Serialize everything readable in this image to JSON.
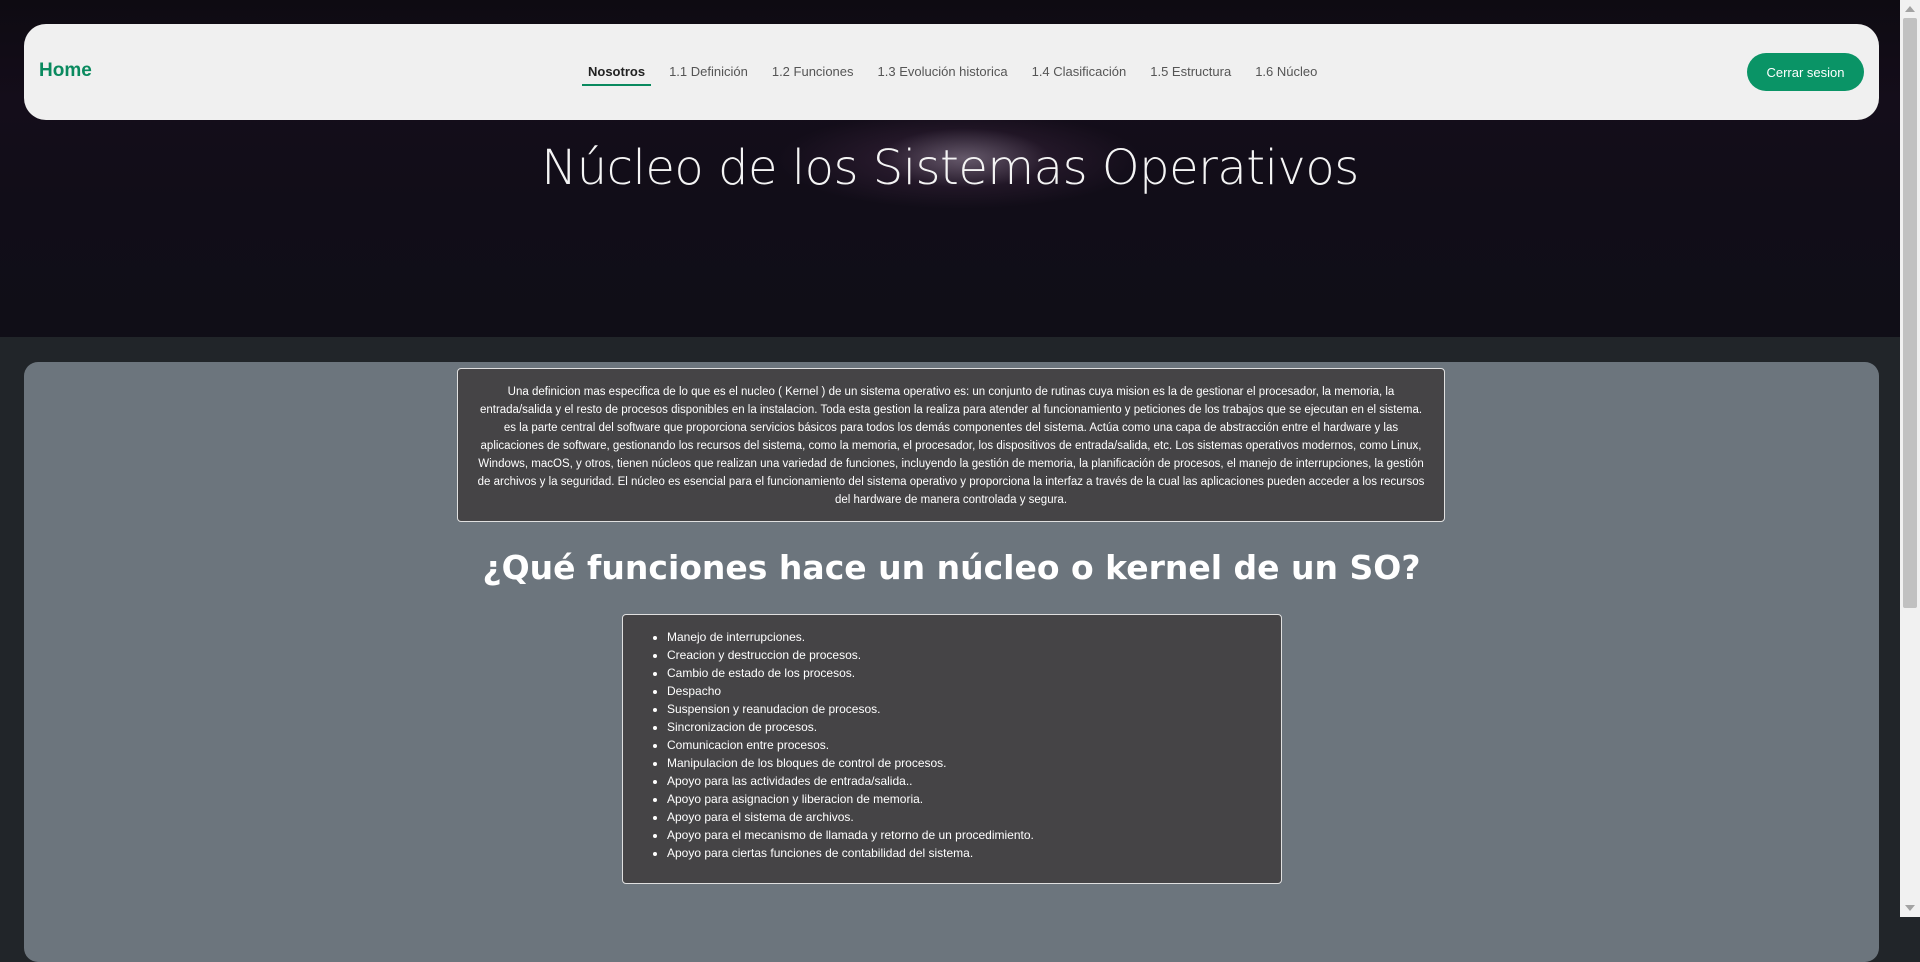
{
  "navbar": {
    "brand": "Home",
    "links": [
      {
        "label": "Nosotros",
        "active": true
      },
      {
        "label": "1.1 Definición"
      },
      {
        "label": "1.2 Funciones"
      },
      {
        "label": "1.3 Evolución historica"
      },
      {
        "label": "1.4 Clasificación"
      },
      {
        "label": "1.5 Estructura"
      },
      {
        "label": "1.6 Núcleo"
      }
    ],
    "logout_label": "Cerrar sesion"
  },
  "hero": {
    "title": "Núcleo de los Sistemas Operativos"
  },
  "main": {
    "intro_text": "Una definicion mas especifica de lo que es el nucleo ( Kernel ) de un sistema operativo es: un conjunto de rutinas cuya mision es la de gestionar el procesador, la memoria, la entrada/salida y el resto de procesos disponibles en la instalacion. Toda esta gestion la realiza para atender al funcionamiento y peticiones de los trabajos que se ejecutan en el sistema. es la parte central del software que proporciona servicios básicos para todos los demás componentes del sistema. Actúa como una capa de abstracción entre el hardware y las aplicaciones de software, gestionando los recursos del sistema, como la memoria, el procesador, los dispositivos de entrada/salida, etc. Los sistemas operativos modernos, como Linux, Windows, macOS, y otros, tienen núcleos que realizan una variedad de funciones, incluyendo la gestión de memoria, la planificación de procesos, el manejo de interrupciones, la gestión de archivos y la seguridad. El núcleo es esencial para el funcionamiento del sistema operativo y proporciona la interfaz a través de la cual las aplicaciones pueden acceder a los recursos del hardware de manera controlada y segura.",
    "section_title": "¿Qué funciones hace un núcleo o kernel de un SO?",
    "functions": [
      "Manejo de interrupciones.",
      "Creacion y destruccion de procesos.",
      "Cambio de estado de los procesos.",
      "Despacho",
      "Suspension y reanudacion de procesos.",
      "Sincronizacion de procesos.",
      "Comunicacion entre procesos.",
      "Manipulacion de los bloques de control de procesos.",
      "Apoyo para las actividades de entrada/salida..",
      "Apoyo para asignacion y liberacion de memoria.",
      "Apoyo para el sistema de archivos.",
      "Apoyo para el mecanismo de llamada y retorno de un procedimiento.",
      "Apoyo para ciertas funciones de contabilidad del sistema."
    ]
  },
  "colors": {
    "accent": "#0a9466",
    "brand": "#0a8a5f",
    "main_bg": "#6c757d",
    "box_bg": "#454446"
  },
  "icons": [
    "scroll-up-arrow-icon",
    "scroll-down-arrow-icon"
  ]
}
